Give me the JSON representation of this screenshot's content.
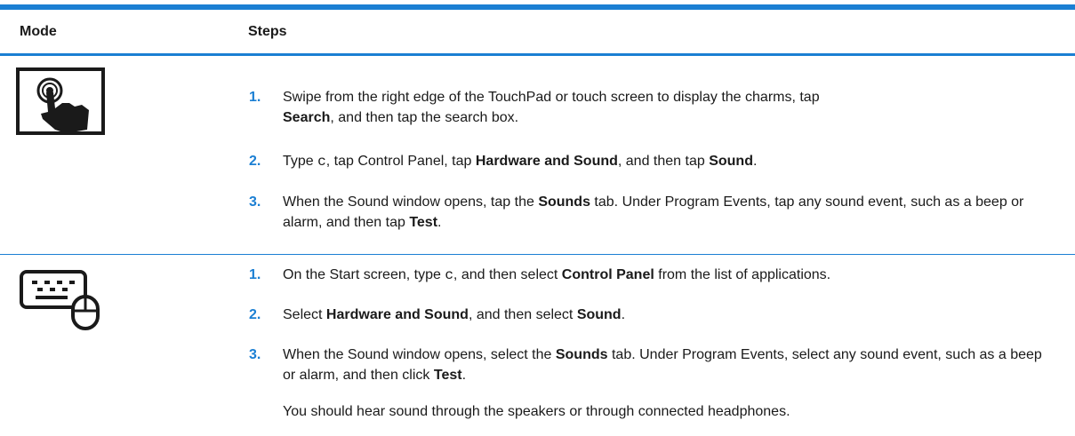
{
  "header": {
    "col1": "Mode",
    "col2": "Steps"
  },
  "icons": {
    "touch": "touch-gesture-icon",
    "keyboard_mouse": "keyboard-mouse-icon"
  },
  "colors": {
    "accent": "#1b7fd3"
  },
  "touch_steps": [
    {
      "num": "1.",
      "a": "Swipe from the right edge of the TouchPad or touch screen to display the charms, tap",
      "b": "Search",
      "c": ", and then tap the search box."
    },
    {
      "num": "2.",
      "a": "Type ",
      "code": "c",
      "b1": ", tap Control Panel, tap ",
      "bold1": "Hardware and Sound",
      "b2": ", and then tap ",
      "bold2": "Sound",
      "end": "."
    },
    {
      "num": "3.",
      "a": "When the Sound window opens, tap the ",
      "bold1": "Sounds",
      "b1": " tab. Under Program Events, tap any sound event, such as a beep or alarm, and then tap ",
      "bold2": "Test",
      "end": "."
    }
  ],
  "kbd_steps": [
    {
      "num": "1.",
      "a": "On the Start screen, type ",
      "code": "c",
      "b1": ", and then select ",
      "bold1": "Control Panel",
      "b2": " from the list of applications."
    },
    {
      "num": "2.",
      "a": "Select ",
      "bold1": "Hardware and Sound",
      "b1": ", and then select ",
      "bold2": "Sound",
      "end": "."
    },
    {
      "num": "3.",
      "a": "When the Sound window opens, select the ",
      "bold1": "Sounds",
      "b1": " tab. Under Program Events, select any sound event, such as a beep or alarm, and then click ",
      "bold2": "Test",
      "end": "."
    }
  ],
  "note": "You should hear sound through the speakers or through connected headphones."
}
